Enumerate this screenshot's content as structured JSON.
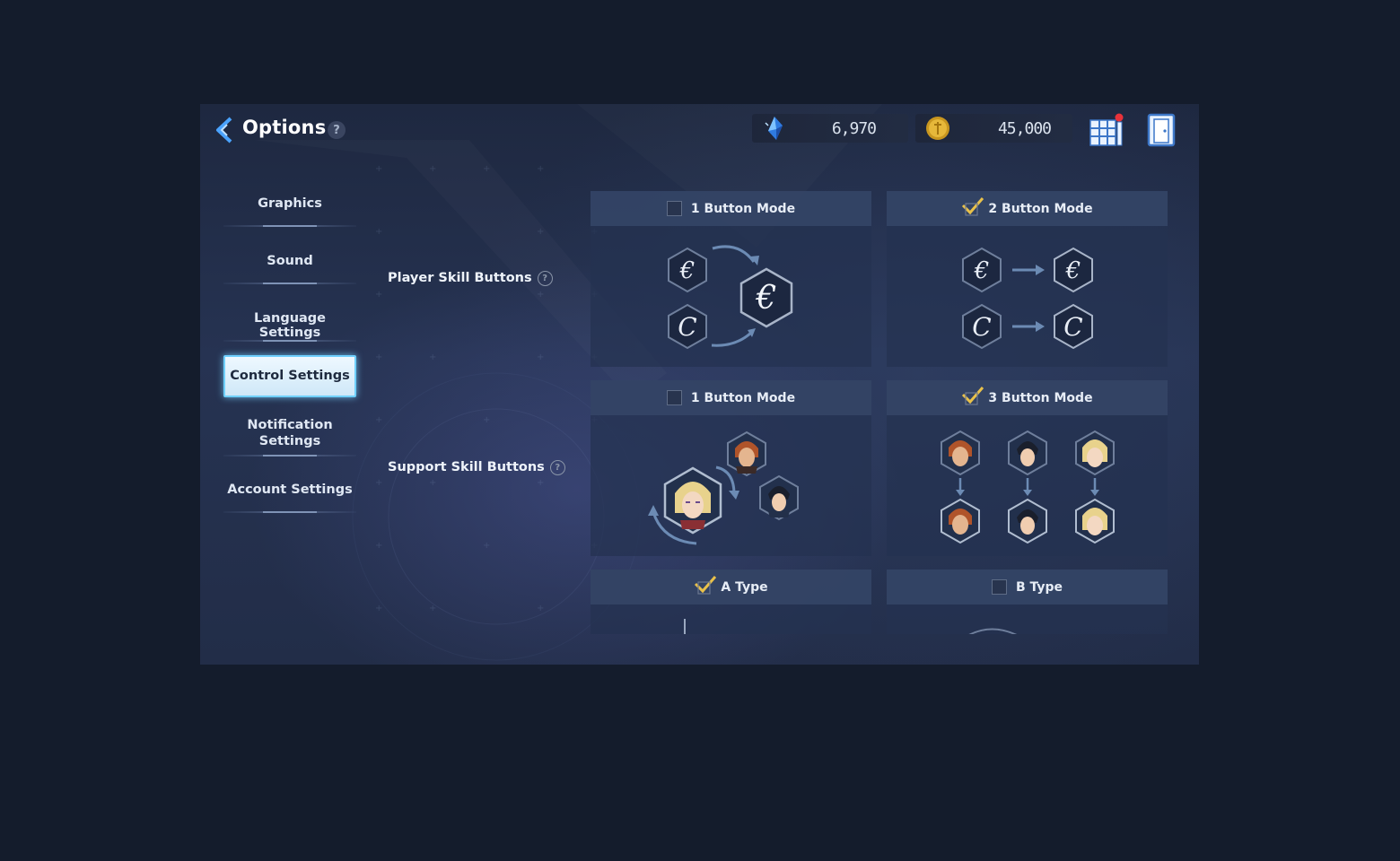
{
  "header": {
    "title": "Options",
    "help": "?",
    "gems": "6,970",
    "gold": "45,000"
  },
  "sidebar": {
    "items": [
      {
        "label": "Graphics"
      },
      {
        "label": "Sound"
      },
      {
        "label": "Language Settings"
      },
      {
        "label": "Control Settings"
      },
      {
        "label": "Notification Settings"
      },
      {
        "label": "Account Settings"
      }
    ],
    "active": "Control Settings"
  },
  "rows": {
    "player": {
      "label": "Player Skill Buttons",
      "options": [
        {
          "label": "1 Button Mode",
          "checked": false
        },
        {
          "label": "2 Button Mode",
          "checked": true
        }
      ]
    },
    "support": {
      "label": "Support Skill Buttons",
      "options": [
        {
          "label": "1 Button Mode",
          "checked": false
        },
        {
          "label": "3 Button Mode",
          "checked": true
        }
      ]
    },
    "type": {
      "options": [
        {
          "label": "A Type",
          "checked": true
        },
        {
          "label": "B Type",
          "checked": false
        }
      ]
    }
  },
  "help_mark": "?",
  "colors": {
    "accent_check": "#e9c14a",
    "active_tab_border": "#6fd0ff",
    "back_arrow": "#4aa3ff",
    "notification_badge": "#e8323a"
  },
  "icons": {
    "back": "chevron-left-icon",
    "gem": "crystal-gem-icon",
    "coin": "gold-coin-icon",
    "menu": "grid-menu-icon",
    "exit": "exit-door-icon"
  }
}
